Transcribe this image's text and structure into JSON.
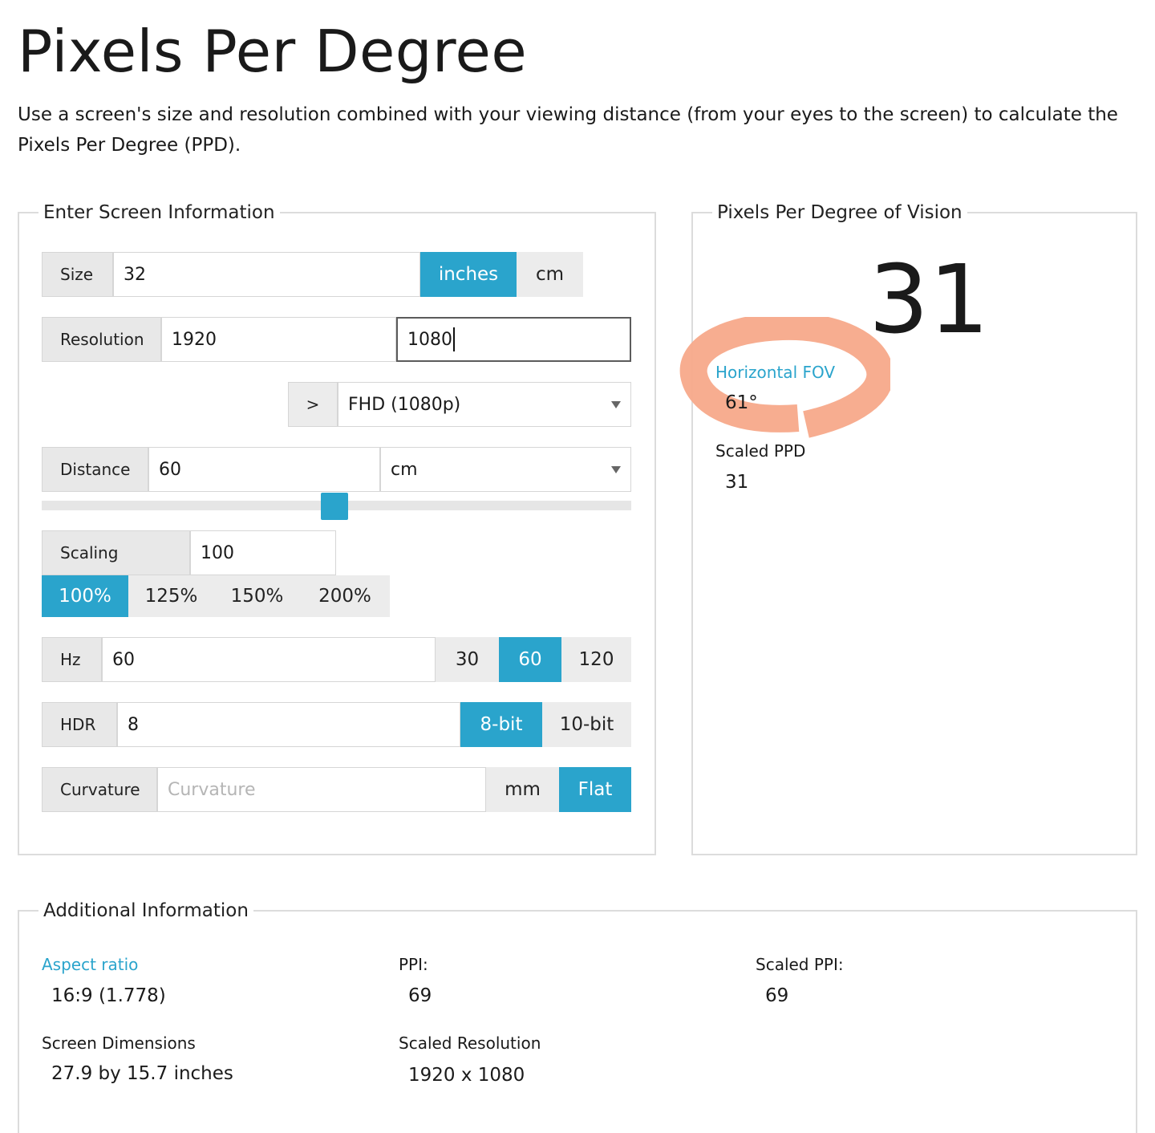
{
  "page": {
    "title": "Pixels Per Degree",
    "intro": "Use a screen's size and resolution combined with your viewing distance (from your eyes to the screen) to calculate the Pixels Per Degree (PPD)."
  },
  "input_panel": {
    "legend": "Enter Screen Information",
    "size": {
      "label": "Size",
      "value": "32",
      "unit_inches": "inches",
      "unit_cm": "cm",
      "active_unit": "inches"
    },
    "resolution": {
      "label": "Resolution",
      "width": "1920",
      "height": "1080"
    },
    "preset": {
      "toggle": ">",
      "selected": "FHD (1080p)"
    },
    "distance": {
      "label": "Distance",
      "value": "60",
      "unit": "cm",
      "slider_fraction": 0.47
    },
    "scaling": {
      "label": "Scaling",
      "value": "100",
      "options": [
        "100%",
        "125%",
        "150%",
        "200%"
      ],
      "active": "100%"
    },
    "hz": {
      "label": "Hz",
      "value": "60",
      "options": [
        "30",
        "60",
        "120"
      ],
      "active": "60"
    },
    "hdr": {
      "label": "HDR",
      "value": "8",
      "options": [
        "8-bit",
        "10-bit"
      ],
      "active": "8-bit"
    },
    "curvature": {
      "label": "Curvature",
      "placeholder": "Curvature",
      "unit": "mm",
      "flat": "Flat"
    }
  },
  "result_panel": {
    "legend": "Pixels Per Degree of Vision",
    "ppd": "31",
    "horizontal_fov_label": "Horizontal FOV",
    "horizontal_fov_value": "61°",
    "scaled_ppd_label": "Scaled PPD",
    "scaled_ppd_value": "31",
    "annotation_color": "#f7a98a"
  },
  "additional": {
    "legend": "Additional Information",
    "aspect_ratio_label": "Aspect ratio",
    "aspect_ratio_value": "16:9 (1.778)",
    "ppi_label": "PPI:",
    "ppi_value": "69",
    "scaled_ppi_label": "Scaled PPI:",
    "scaled_ppi_value": "69",
    "screen_dimensions_label": "Screen Dimensions",
    "screen_dimensions_value": "27.9 by 15.7 inches",
    "scaled_resolution_label": "Scaled Resolution",
    "scaled_resolution_value": "1920 x 1080"
  },
  "colors": {
    "accent": "#2aa4cc",
    "addon_bg": "#e8e8e8",
    "border": "#dcdcdc"
  }
}
